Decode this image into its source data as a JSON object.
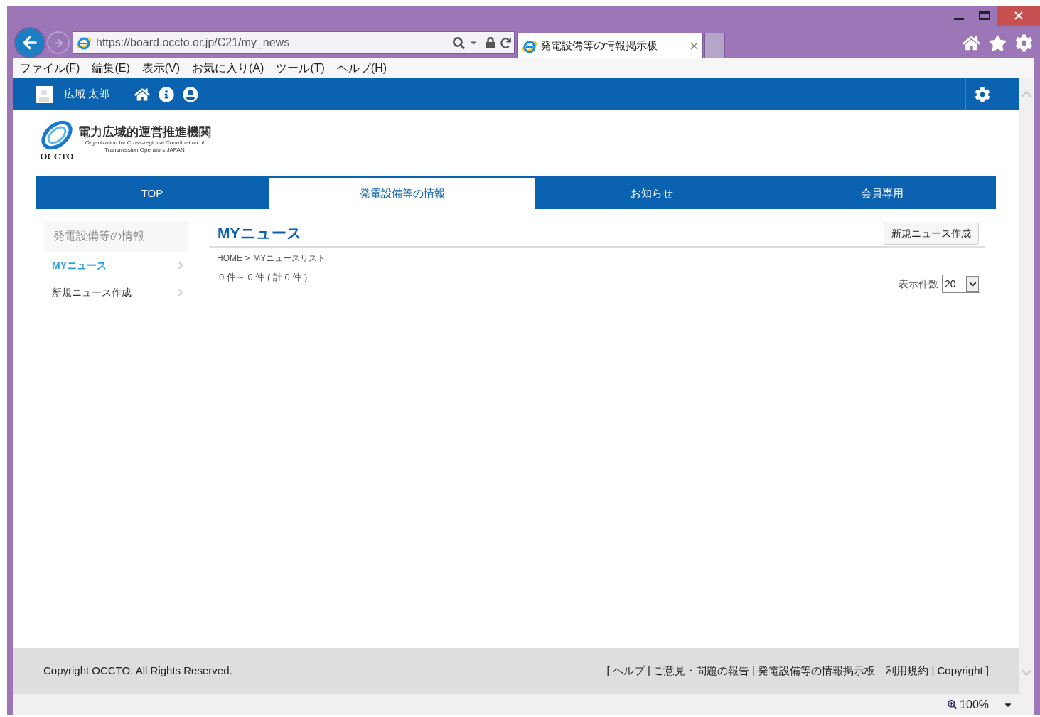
{
  "browser": {
    "url": "https://board.occto.or.jp/C21/my_news",
    "tabs": [
      {
        "title": "発電設備等の情報掲示板",
        "selected": true
      }
    ],
    "menu": [
      "ファイル(F)",
      "編集(E)",
      "表示(V)",
      "お気に入り(A)",
      "ツール(T)",
      "ヘルプ(H)"
    ],
    "zoom": "100%"
  },
  "site": {
    "user_name": "広域 太郎",
    "logo": {
      "name": "電力広域的運営推進機関",
      "english_1": "Organization for Cross-regional Coordination of",
      "english_2": "Transmission Operators,JAPAN",
      "mark": "OCCTO"
    },
    "nav": [
      {
        "label": "TOP",
        "selected": false
      },
      {
        "label": "発電設備等の情報",
        "selected": true
      },
      {
        "label": "お知らせ",
        "selected": false
      },
      {
        "label": "会員専用",
        "selected": false
      }
    ]
  },
  "sidebar": {
    "heading": "発電設備等の情報",
    "items": [
      {
        "label": "MYニュース",
        "selected": true
      },
      {
        "label": "新規ニュース作成",
        "selected": false
      }
    ]
  },
  "main": {
    "title": "MYニュース",
    "new_button": "新規ニュース作成",
    "breadcrumb": [
      "HOME >",
      "MYニュースリスト"
    ],
    "count": "0 件～ 0 件 ( 計 0 件 )",
    "per_page_label": "表示件数",
    "per_page_value": "20"
  },
  "footer": {
    "copyright": "Copyright OCCTO. All Rights Reserved.",
    "links": "[ ヘルプ | ご意見・問題の報告 | 発電設備等の情報掲示板　利用規約 | Copyright ]"
  }
}
